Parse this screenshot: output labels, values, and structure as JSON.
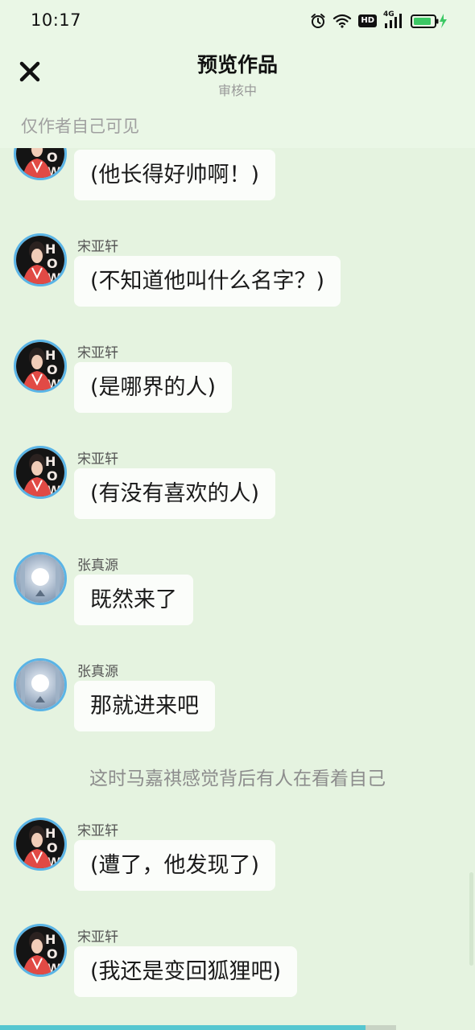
{
  "status_bar": {
    "time": "10:17",
    "icons": [
      "alarm-icon",
      "wifi-icon",
      "hd-icon",
      "signal-4g-icon",
      "battery-charging-icon"
    ],
    "hd_label": "HD",
    "network_label": "4G"
  },
  "header": {
    "close_icon": "close-icon",
    "title": "预览作品",
    "subtitle": "审核中",
    "visibility_note": "仅作者自己可见"
  },
  "messages": [
    {
      "type": "chat",
      "sender": "",
      "avatar": "avatar-song-yaxuan",
      "text": "(他长得好帅啊！)"
    },
    {
      "type": "chat",
      "sender": "宋亚轩",
      "avatar": "avatar-song-yaxuan",
      "text": "(不知道他叫什么名字？)"
    },
    {
      "type": "chat",
      "sender": "宋亚轩",
      "avatar": "avatar-song-yaxuan",
      "text": "(是哪界的人)"
    },
    {
      "type": "chat",
      "sender": "宋亚轩",
      "avatar": "avatar-song-yaxuan",
      "text": "(有没有喜欢的人)"
    },
    {
      "type": "chat",
      "sender": "张真源",
      "avatar": "avatar-zhang-zhenyuan",
      "text": "既然来了"
    },
    {
      "type": "chat",
      "sender": "张真源",
      "avatar": "avatar-zhang-zhenyuan",
      "text": "那就进来吧"
    },
    {
      "type": "narration",
      "text": "这时马嘉祺感觉背后有人在看着自己"
    },
    {
      "type": "chat",
      "sender": "宋亚轩",
      "avatar": "avatar-song-yaxuan",
      "text": "(遭了，他发现了)"
    },
    {
      "type": "chat",
      "sender": "宋亚轩",
      "avatar": "avatar-song-yaxuan",
      "text": "(我还是变回狐狸吧)"
    }
  ],
  "colors": {
    "background": "#e5f3e0",
    "header_background": "#eaf7e6",
    "bubble": "#fbfdfa",
    "avatar_ring": "#5ab4e6",
    "progress": "#55c6d0"
  },
  "reading_progress": 0.77
}
